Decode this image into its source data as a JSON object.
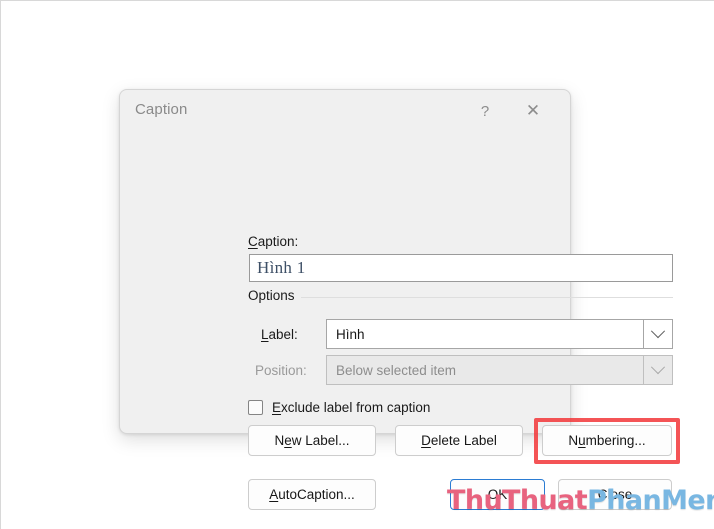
{
  "window": {
    "title": "Caption",
    "help_icon": "?",
    "close_icon": "✕"
  },
  "caption_section": {
    "label_prefix": "C",
    "label_rest": "aption:",
    "value": "Hình 1",
    "placeholder": ""
  },
  "options": {
    "legend": "Options",
    "label_row": {
      "label_prefix": "L",
      "label_rest": "abel:",
      "value": "Hình",
      "arrow_icon": "chevron-down-icon"
    },
    "position_row": {
      "label": "Position:",
      "value": "Below selected item",
      "arrow_icon": "chevron-down-icon",
      "disabled": true
    },
    "exclude_checkbox": {
      "checked": false,
      "label_prefix": "E",
      "label_rest": "xclude label from caption"
    }
  },
  "buttons": {
    "new_label": {
      "prefix": "N",
      "key": "e",
      "rest": "w Label..."
    },
    "delete_label": {
      "prefix": "",
      "key": "D",
      "rest": "elete Label"
    },
    "numbering": {
      "prefix": "N",
      "key": "u",
      "rest": "mbering..."
    },
    "autocaption": {
      "prefix": "",
      "key": "A",
      "rest": "utoCaption..."
    },
    "ok": "OK",
    "close": "Close"
  },
  "annotation": {
    "highlight_target": "numbering-button",
    "highlight_color": "#f2383a"
  },
  "watermark": {
    "part_a": "ThuThuat",
    "part_b": "PhanMem.vn",
    "color_a": "#e8637f",
    "color_b": "#79b7e2"
  }
}
